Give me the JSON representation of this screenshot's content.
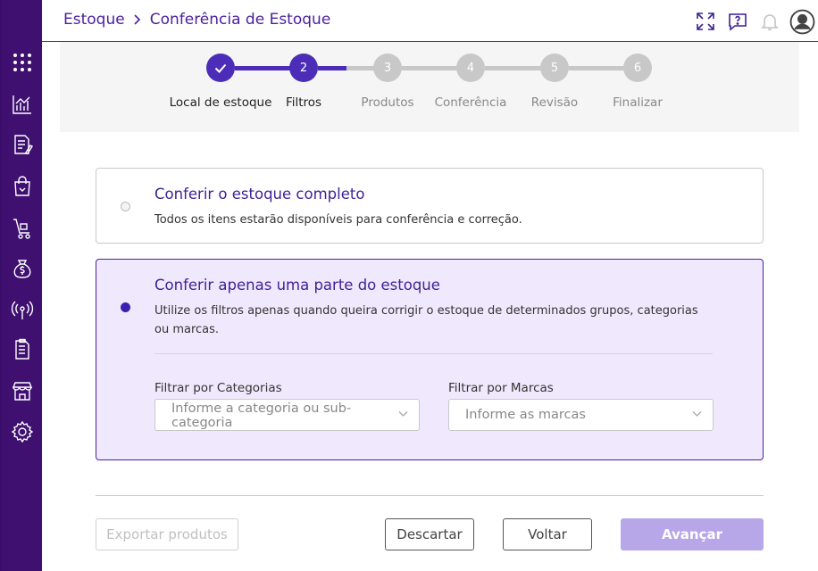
{
  "breadcrumb": {
    "parent": "Estoque",
    "current": "Conferência de Estoque"
  },
  "stepper": {
    "steps": [
      {
        "number": "",
        "label": "Local de estoque",
        "state": "done"
      },
      {
        "number": "2",
        "label": "Filtros",
        "state": "active"
      },
      {
        "number": "3",
        "label": "Produtos",
        "state": "pending"
      },
      {
        "number": "4",
        "label": "Conferência",
        "state": "pending"
      },
      {
        "number": "5",
        "label": "Revisão",
        "state": "pending"
      },
      {
        "number": "6",
        "label": "Finalizar",
        "state": "pending"
      }
    ]
  },
  "options": {
    "full": {
      "title": "Conferir o estoque completo",
      "description": "Todos os itens estarão disponíveis para conferência e correção.",
      "selected": false
    },
    "partial": {
      "title": "Conferir apenas uma parte do estoque",
      "description_line1": "Utilize os filtros apenas quando queira corrigir o estoque de determinados grupos, categorias",
      "description_line2": "ou marcas.",
      "selected": true
    }
  },
  "filters": {
    "categories": {
      "label": "Filtrar por Categorias",
      "placeholder_line1": "Informe a categoria ou sub-",
      "placeholder_line2": "categoria"
    },
    "brands": {
      "label": "Filtrar por Marcas",
      "placeholder": "Informe as marcas"
    }
  },
  "buttons": {
    "export": "Exportar produtos",
    "discard": "Descartar",
    "back": "Voltar",
    "next": "Avançar"
  },
  "colors": {
    "sidebar": "#3f1070",
    "accent": "#4a1f9e",
    "step_active": "#4b2db8",
    "step_pending": "#c8c8c8",
    "selected_bg": "#f0e9fd",
    "next_button": "#b7a6e8"
  },
  "sidebar_icons": [
    "apps-grid-icon",
    "chart-icon",
    "document-edit-icon",
    "shopping-bag-icon",
    "cart-icon",
    "money-bag-icon",
    "broadcast-icon",
    "report-icon",
    "store-icon",
    "settings-icon"
  ],
  "header_icons": [
    "expand-icon",
    "help-chat-icon",
    "bell-icon",
    "user-avatar-icon"
  ]
}
